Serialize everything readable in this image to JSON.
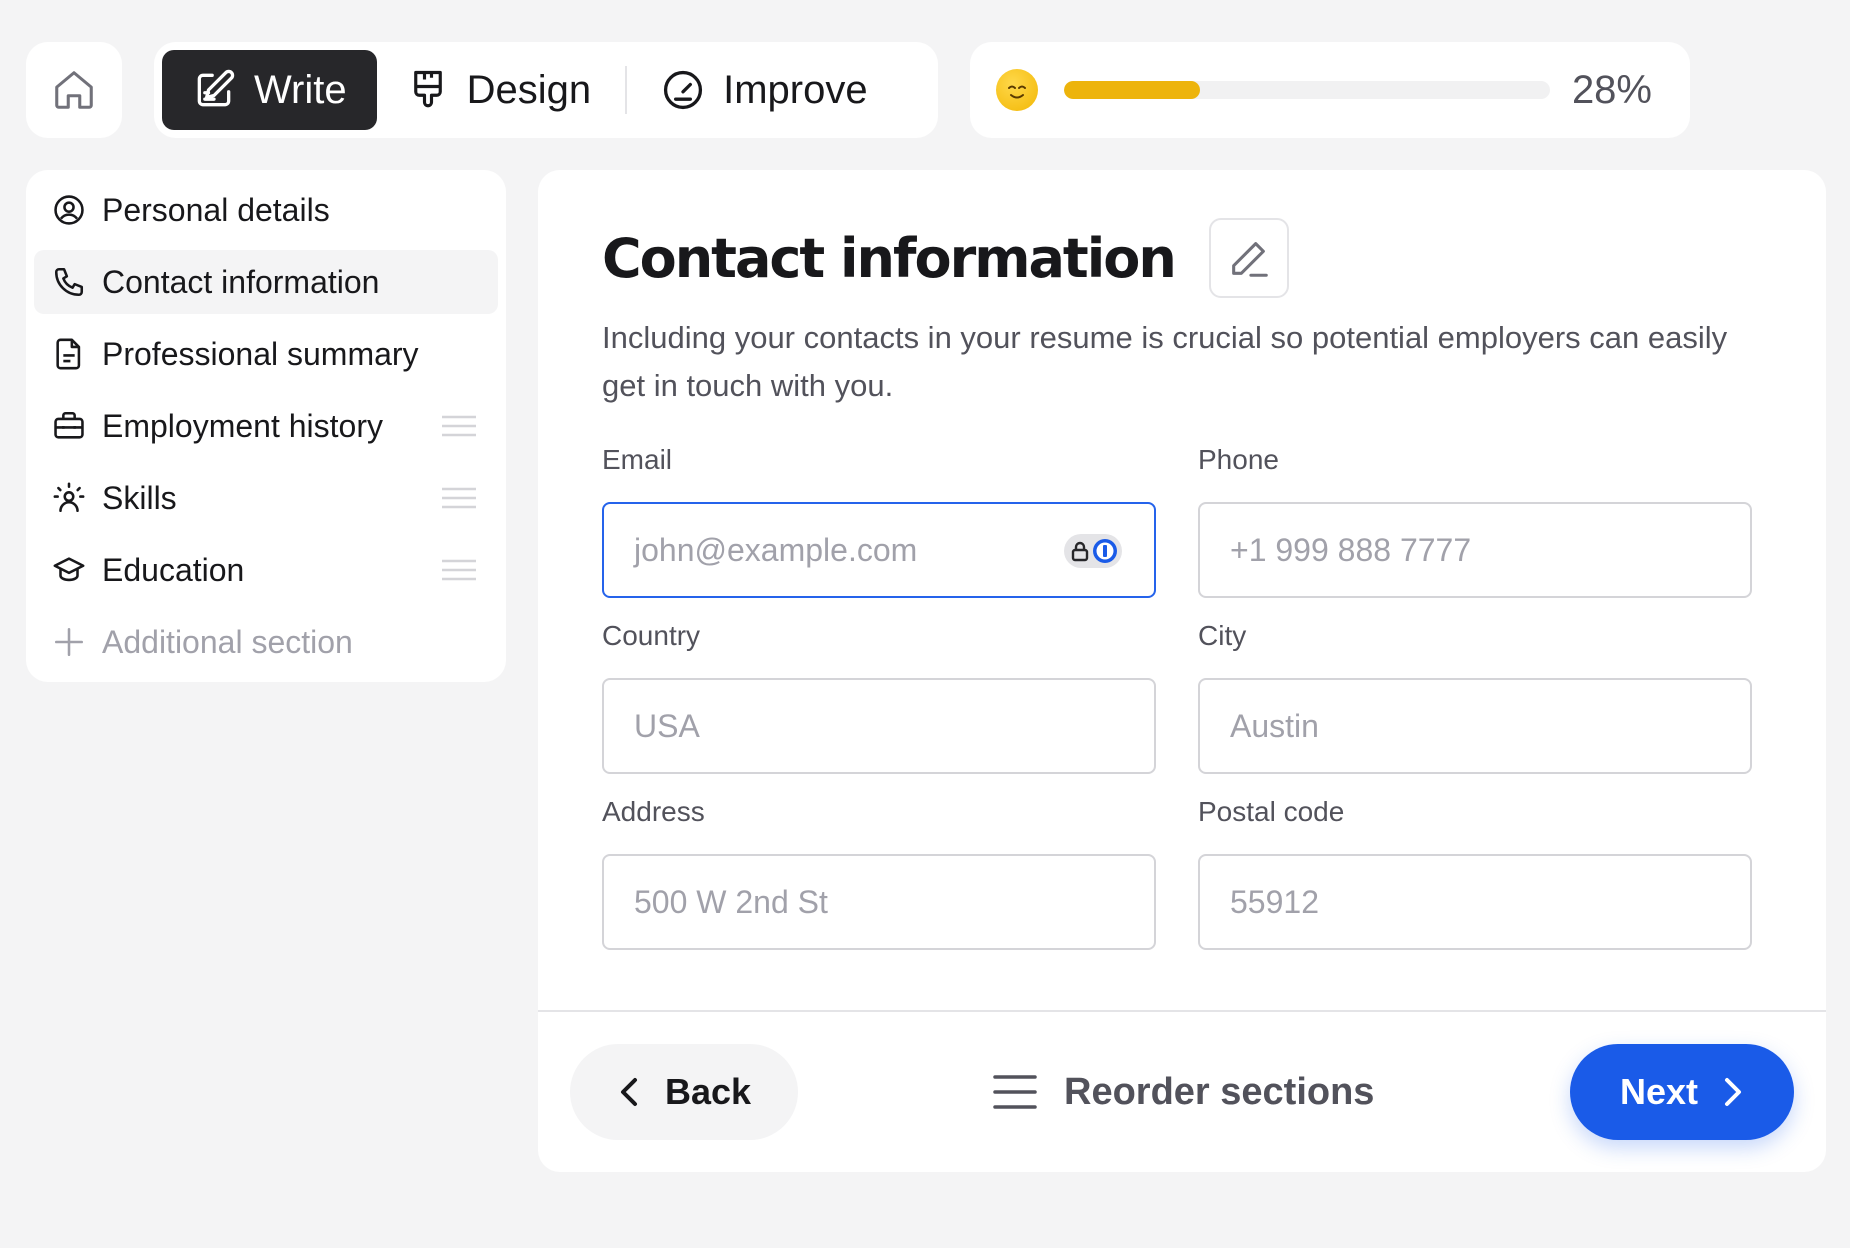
{
  "modes": {
    "write": "Write",
    "design": "Design",
    "improve": "Improve"
  },
  "progress": {
    "label": "28%",
    "value": 0.28
  },
  "sidebar": {
    "items": [
      {
        "label": "Personal details"
      },
      {
        "label": "Contact information"
      },
      {
        "label": "Professional summary"
      },
      {
        "label": "Employment history"
      },
      {
        "label": "Skills"
      },
      {
        "label": "Education"
      },
      {
        "label": "Additional section"
      }
    ]
  },
  "main": {
    "title": "Contact information",
    "subtitle": "Including your contacts in your resume is crucial so potential employers can easily get in touch with you.",
    "fields": {
      "email": {
        "label": "Email",
        "placeholder": "john@example.com"
      },
      "phone": {
        "label": "Phone",
        "placeholder": "+1 999 888 7777"
      },
      "country": {
        "label": "Country",
        "placeholder": "USA"
      },
      "city": {
        "label": "City",
        "placeholder": "Austin"
      },
      "address": {
        "label": "Address",
        "placeholder": "500 W 2nd St"
      },
      "postal": {
        "label": "Postal code",
        "placeholder": "55912"
      }
    }
  },
  "footer": {
    "back": "Back",
    "reorder": "Reorder sections",
    "next": "Next"
  },
  "colors": {
    "accent": "#1a5be8",
    "progress": "#edb40c",
    "focus_border": "#2563eb"
  }
}
